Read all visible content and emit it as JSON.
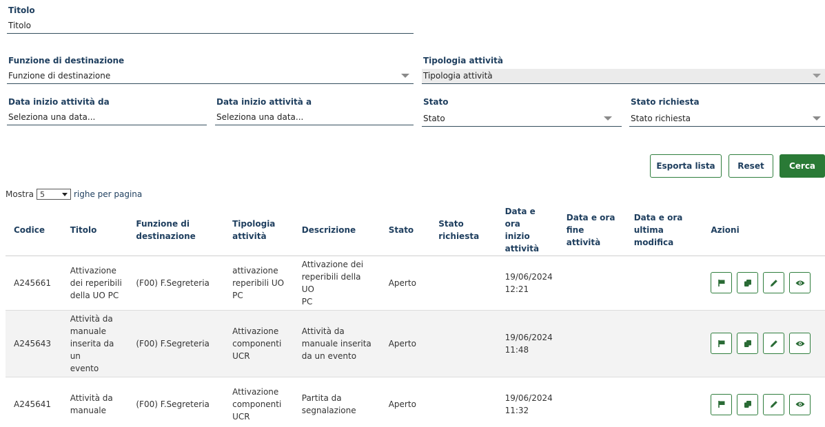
{
  "filters": {
    "titolo": {
      "label": "Titolo",
      "placeholder": "Titolo"
    },
    "funzione": {
      "label": "Funzione di destinazione",
      "value": "Funzione di destinazione"
    },
    "tipologia": {
      "label": "Tipologia attività",
      "value": "Tipologia attività"
    },
    "data_da": {
      "label": "Data inizio attività da",
      "placeholder": "Seleziona una data..."
    },
    "data_a": {
      "label": "Data inizio attività a",
      "placeholder": "Seleziona una data..."
    },
    "stato": {
      "label": "Stato",
      "value": "Stato"
    },
    "stato_richiesta": {
      "label": "Stato richiesta",
      "value": "Stato richiesta"
    }
  },
  "buttons": {
    "esporta": "Esporta lista",
    "reset": "Reset",
    "cerca": "Cerca"
  },
  "pagination": {
    "prefix": "Mostra",
    "value": "5",
    "suffix": "righe per pagina"
  },
  "table": {
    "headers": [
      [
        "Codice"
      ],
      [
        "Titolo"
      ],
      [
        "Funzione di",
        "destinazione"
      ],
      [
        "Tipologia",
        "attività"
      ],
      [
        "Descrizione"
      ],
      [
        "Stato"
      ],
      [
        "Stato",
        "richiesta"
      ],
      [
        "Data e ora",
        "inizio",
        "attività"
      ],
      [
        "Data e ora",
        "fine",
        "attività"
      ],
      [
        "Data e ora",
        "ultima",
        "modifica"
      ],
      [
        "Azioni"
      ]
    ],
    "rows": [
      {
        "codice": "A245661",
        "titolo": [
          "Attivazione",
          "dei reperibili",
          "della UO PC"
        ],
        "funzione": "(F00) F.Segreteria",
        "tipologia": [
          "attivazione",
          "reperibili UO",
          "PC"
        ],
        "descrizione": [
          "Attivazione dei",
          "reperibili della UO",
          "PC"
        ],
        "stato": "Aperto",
        "stato_richiesta": "",
        "inizio": [
          "19/06/2024",
          "12:21"
        ],
        "fine": "",
        "modifica": ""
      },
      {
        "codice": "A245643",
        "titolo": [
          "Attività da",
          "manuale",
          "inserita da un",
          "evento"
        ],
        "funzione": "(F00) F.Segreteria",
        "tipologia": [
          "Attivazione",
          "componenti",
          "UCR"
        ],
        "descrizione": [
          "Attività da",
          "manuale inserita",
          "da un evento"
        ],
        "stato": "Aperto",
        "stato_richiesta": "",
        "inizio": [
          "19/06/2024",
          "11:48"
        ],
        "fine": "",
        "modifica": ""
      },
      {
        "codice": "A245641",
        "titolo": [
          "Attività da",
          "manuale"
        ],
        "funzione": "(F00) F.Segreteria",
        "tipologia": [
          "Attivazione",
          "componenti",
          "UCR"
        ],
        "descrizione": [
          "Partita da",
          "segnalazione"
        ],
        "stato": "Aperto",
        "stato_richiesta": "",
        "inizio": [
          "19/06/2024",
          "11:32"
        ],
        "fine": "",
        "modifica": ""
      }
    ],
    "action_icons": [
      "flag-icon",
      "copy-icon",
      "pencil-icon",
      "eye-icon"
    ]
  },
  "colors": {
    "accent": "#2a7a36",
    "label": "#1e3e5e",
    "row_alt": "#f3f3f3"
  }
}
